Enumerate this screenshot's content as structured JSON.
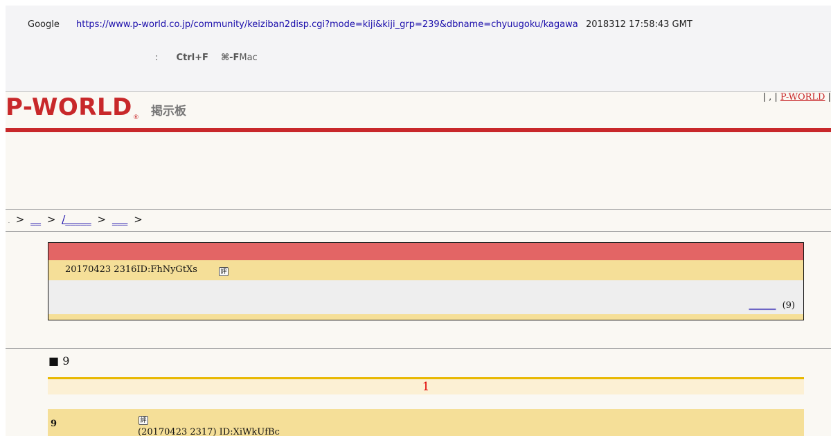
{
  "cache_banner": {
    "source": "Google",
    "url": "https://www.p-world.co.jp/community/keiziban2disp.cgi?mode=kiji&kiji_grp=239&dbname=chyuugoku/kagawa",
    "timestamp": "2018312 17:58:43 GMT",
    "hint_colon": ":",
    "hint_key_win": "Ctrl+F",
    "hint_key_mac": "⌘-F",
    "hint_mac": "Mac"
  },
  "header": {
    "logo_text": "P-WORLD",
    "logo_reg": "®",
    "subtitle": "掲示板",
    "links_prefix": "| , |",
    "link_pworld": "P-WORLD",
    "links_suffix": "|"
  },
  "breadcrumb": {
    "tiny": ".",
    "sep": ">",
    "links": [
      "__",
      "/_____",
      "___"
    ]
  },
  "thread": {
    "meta": "20170423 2316ID:FhNyGtXs",
    "hyo": "評",
    "reply_link": "______",
    "reply_count": "(9)"
  },
  "responses": {
    "heading": "■ 9",
    "page_number": "1"
  },
  "post": {
    "number": "9",
    "hyo": "評",
    "meta": "(20170423 2317) ID:XiWkUfBc"
  }
}
